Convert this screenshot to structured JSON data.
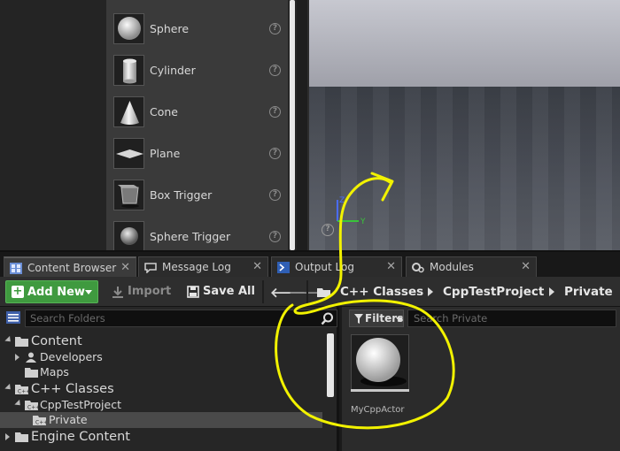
{
  "shape_list": {
    "items": [
      {
        "label": "Sphere",
        "shape": "sphere-icon"
      },
      {
        "label": "Cylinder",
        "shape": "cylinder-icon"
      },
      {
        "label": "Cone",
        "shape": "cone-icon"
      },
      {
        "label": "Plane",
        "shape": "plane-icon"
      },
      {
        "label": "Box Trigger",
        "shape": "box-trigger-icon"
      },
      {
        "label": "Sphere Trigger",
        "shape": "sphere-trigger-icon"
      }
    ],
    "help_glyph": "?"
  },
  "viewport": {
    "axis_labels": {
      "z": "Z",
      "y": "Y"
    },
    "help_glyph": "?"
  },
  "tabs": [
    {
      "label": "Content Browser",
      "icon": "content-browser-icon",
      "active": true
    },
    {
      "label": "Message Log",
      "icon": "message-log-icon",
      "active": false
    },
    {
      "label": "Output Log",
      "icon": "output-log-icon",
      "active": false
    },
    {
      "label": "Modules",
      "icon": "modules-icon",
      "active": false
    }
  ],
  "tab_close_glyph": "✕",
  "toolbar": {
    "add_new_label": "Add New",
    "import_label": "Import",
    "save_all_label": "Save All",
    "back_glyph": "🡐",
    "forward_glyph": "🡒"
  },
  "breadcrumb": [
    "C++ Classes",
    "CppTestProject",
    "Private"
  ],
  "folder_pane": {
    "search_placeholder": "Search Folders",
    "tree": [
      {
        "label": "Content",
        "level": 0,
        "expanded": true,
        "size": "big"
      },
      {
        "label": "Developers",
        "level": 1,
        "expanded": false,
        "size": "small",
        "icon": "developer-icon"
      },
      {
        "label": "Maps",
        "level": 1,
        "expanded": null,
        "size": "small",
        "icon": "folder-icon"
      },
      {
        "label": "C++ Classes",
        "level": 0,
        "expanded": true,
        "size": "big",
        "icon": "cpp-folder-icon"
      },
      {
        "label": "CppTestProject",
        "level": 1,
        "expanded": true,
        "size": "small",
        "icon": "cpp-folder-icon"
      },
      {
        "label": "Private",
        "level": 2,
        "expanded": null,
        "size": "small",
        "icon": "cpp-folder-icon",
        "selected": true
      },
      {
        "label": "Engine Content",
        "level": 0,
        "expanded": false,
        "size": "big",
        "icon": "folder-icon"
      }
    ]
  },
  "asset_pane": {
    "filters_label": "Filters",
    "search_placeholder": "Search Private",
    "assets": [
      {
        "name": "MyCppActor",
        "icon": "actor-sphere-icon"
      }
    ]
  },
  "colors": {
    "accent_green": "#3f9a3f",
    "annotation_yellow": "#f2f200",
    "axis_y": "#39c43a",
    "axis_z": "#4a6cff"
  }
}
